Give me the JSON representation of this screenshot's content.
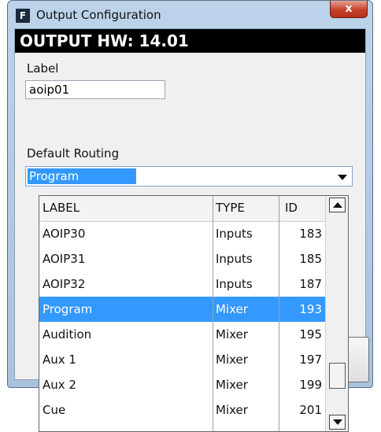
{
  "window": {
    "title": "Output Configuration",
    "app_icon_letter": "F",
    "close_label": "x"
  },
  "header": {
    "text": "OUTPUT HW: 14.01"
  },
  "label_field": {
    "caption": "Label",
    "value": "aoip01"
  },
  "routing": {
    "caption": "Default Routing",
    "selected": "Program"
  },
  "list": {
    "columns": [
      "LABEL",
      "TYPE",
      "ID"
    ],
    "rows": [
      {
        "label": "AOIP30",
        "type": "Inputs",
        "id": "183"
      },
      {
        "label": "AOIP31",
        "type": "Inputs",
        "id": "185"
      },
      {
        "label": "AOIP32",
        "type": "Inputs",
        "id": "187"
      },
      {
        "label": "Program",
        "type": "Mixer",
        "id": "193"
      },
      {
        "label": "Audition",
        "type": "Mixer",
        "id": "195"
      },
      {
        "label": "Aux 1",
        "type": "Mixer",
        "id": "197"
      },
      {
        "label": "Aux 2",
        "type": "Mixer",
        "id": "199"
      },
      {
        "label": "Cue",
        "type": "Mixer",
        "id": "201"
      }
    ],
    "selected_index": 3
  },
  "colors": {
    "selection": "#3399ff",
    "header_bg": "#000000",
    "close_button": "#c7412b"
  }
}
